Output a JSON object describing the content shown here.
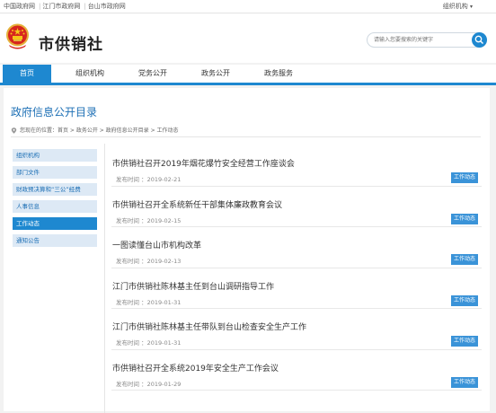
{
  "topbar": {
    "links": [
      "中国政府网",
      "江门市政府网",
      "台山市政府网"
    ],
    "org_menu": "组织机构"
  },
  "header": {
    "site_title": "市供销社",
    "search_placeholder": "请输入您要搜索的关键字"
  },
  "nav": {
    "tabs": [
      {
        "label": "首页",
        "active": true
      },
      {
        "label": "组织机构",
        "active": false
      },
      {
        "label": "党务公开",
        "active": false
      },
      {
        "label": "政务公开",
        "active": false
      },
      {
        "label": "政务服务",
        "active": false
      }
    ]
  },
  "main": {
    "page_title": "政府信息公开目录",
    "breadcrumb": "您现在的位置：首页 > 政务公开 > 政府信息公开目录 > 工作动态"
  },
  "sidebar": {
    "items": [
      {
        "label": "组织机构",
        "active": false
      },
      {
        "label": "部门文件",
        "active": false
      },
      {
        "label": "财政预决算和“三公”经费",
        "active": false
      },
      {
        "label": "人事信息",
        "active": false
      },
      {
        "label": "工作动态",
        "active": true
      },
      {
        "label": "通知公告",
        "active": false
      }
    ]
  },
  "articles": [
    {
      "title": "市供销社召开2019年烟花爆竹安全经营工作座谈会",
      "date": "发布时间 ：2019-02-21",
      "tag": "工作动态"
    },
    {
      "title": "市供销社召开全系统新任干部集体廉政教育会议",
      "date": "发布时间 ：2019-02-15",
      "tag": "工作动态"
    },
    {
      "title": "一图读懂台山市机构改革",
      "date": "发布时间 ：2019-02-13",
      "tag": "工作动态"
    },
    {
      "title": "江门市供销社陈林基主任到台山调研指导工作",
      "date": "发布时间 ：2019-01-31",
      "tag": "工作动态"
    },
    {
      "title": "江门市供销社陈林基主任带队到台山检查安全生产工作",
      "date": "发布时间 ：2019-01-31",
      "tag": "工作动态"
    },
    {
      "title": "市供销社召开全系统2019年安全生产工作会议",
      "date": "发布时间 ：2019-01-29",
      "tag": "工作动态"
    }
  ],
  "colors": {
    "accent": "#1e88d0",
    "title_blue": "#1c6fb5",
    "sidebar_bg": "#dde9f5",
    "tag_bg": "#3a93d8"
  }
}
